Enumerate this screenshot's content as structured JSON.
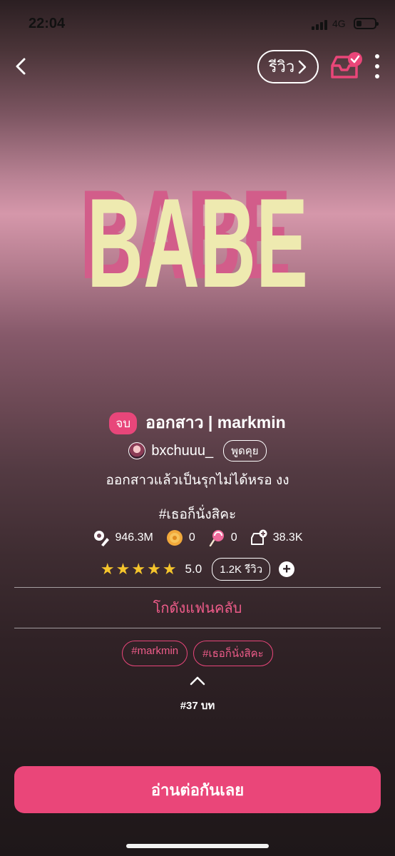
{
  "status_bar": {
    "time": "22:04",
    "network": "4G"
  },
  "header": {
    "review_label": "รีวิว"
  },
  "story": {
    "status_badge": "จบ",
    "title": "ออกสาว | markmin",
    "author": "bxchuuu_",
    "chat_label": "พูดคุย",
    "synopsis": "ออกสาวแล้วเป็นรุกไม่ได้หรอ งง",
    "hashtag": "#เธอก็นั่งสิคะ",
    "cover_text": "BABE"
  },
  "stats": {
    "views": "946.3M",
    "coins": "0",
    "candy": "0",
    "shelf_adds": "38.3K"
  },
  "rating": {
    "stars": 5,
    "score": "5.0",
    "review_count": "1.2K รีวิว"
  },
  "fanclub_label": "โกดังแฟนคลับ",
  "tags": [
    "#markmin",
    "#เธอก็นั่งสิคะ"
  ],
  "episode_count": "#37 บท",
  "read_button_label": "อ่านต่อกันเลย",
  "colors": {
    "accent": "#ea4679",
    "star": "#f5c52c",
    "cover_text": "#eeeab0",
    "cover_shadow": "#d25d8a"
  }
}
